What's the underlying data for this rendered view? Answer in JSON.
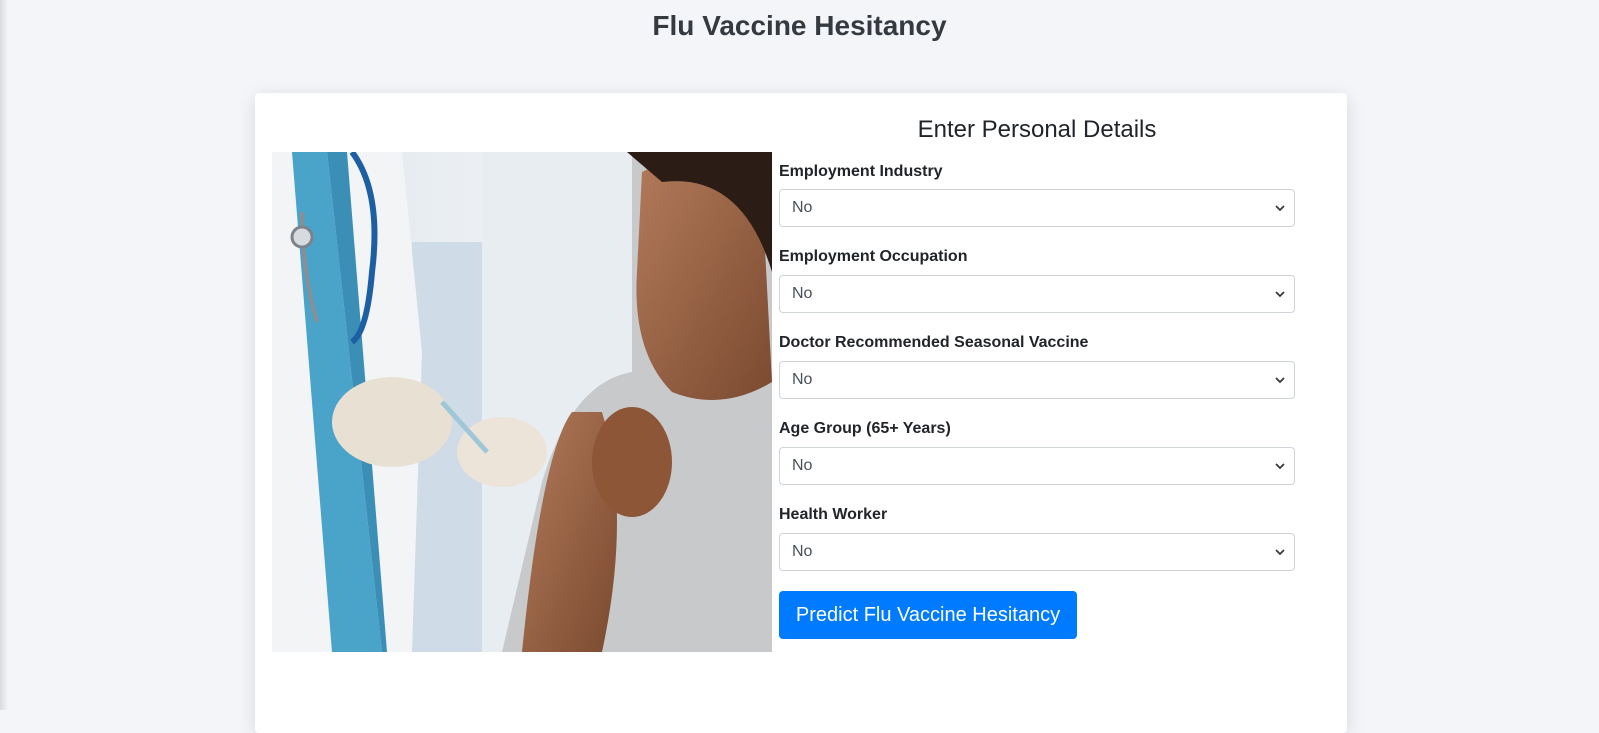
{
  "page": {
    "title": "Flu Vaccine Hesitancy"
  },
  "form": {
    "heading": "Enter Personal Details",
    "fields": [
      {
        "label": "Employment Industry",
        "value": "No"
      },
      {
        "label": "Employment Occupation",
        "value": "No"
      },
      {
        "label": "Doctor Recommended Seasonal Vaccine",
        "value": "No"
      },
      {
        "label": "Age Group (65+ Years)",
        "value": "No"
      },
      {
        "label": "Health Worker",
        "value": "No"
      }
    ],
    "submit_label": "Predict Flu Vaccine Hesitancy"
  },
  "colors": {
    "accent": "#007bff",
    "background": "#f4f5f8",
    "card": "#ffffff"
  },
  "image": {
    "subject": "doctor-giving-vaccine-photo"
  }
}
